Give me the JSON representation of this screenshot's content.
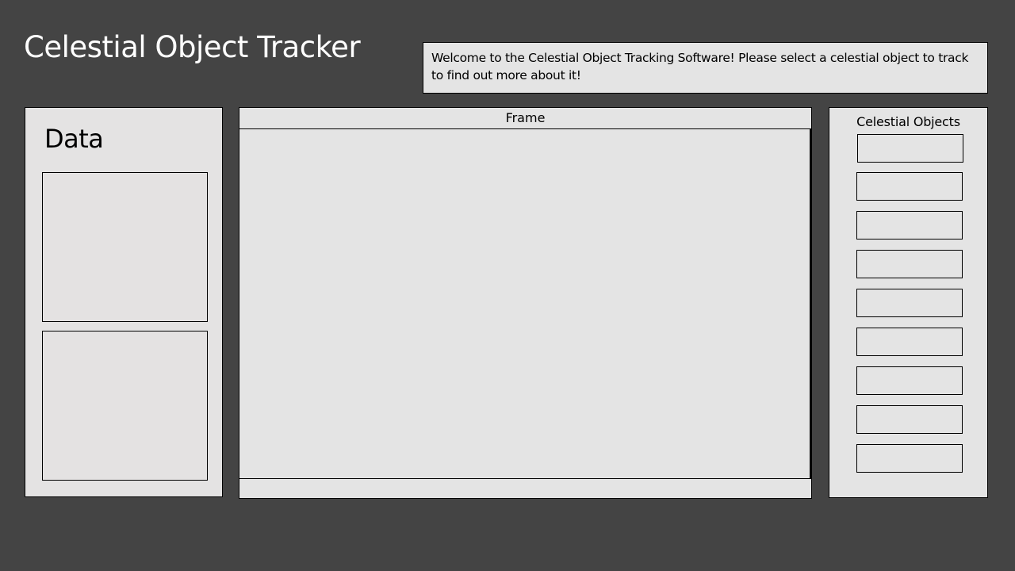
{
  "app": {
    "title": "Celestial Object Tracker"
  },
  "welcome": {
    "message": "Welcome to the Celestial Object Tracking Software! Please select a celestial object to track to find out more about it!"
  },
  "data_panel": {
    "title": "Data"
  },
  "frame_panel": {
    "title": "Frame"
  },
  "objects_panel": {
    "title": "Celestial Objects",
    "items": [
      "",
      "",
      "",
      "",
      "",
      "",
      "",
      "",
      ""
    ]
  },
  "colors": {
    "background": "#444444",
    "panel": "#e4e4e4",
    "border": "#000000",
    "title_text": "#ffffff"
  }
}
